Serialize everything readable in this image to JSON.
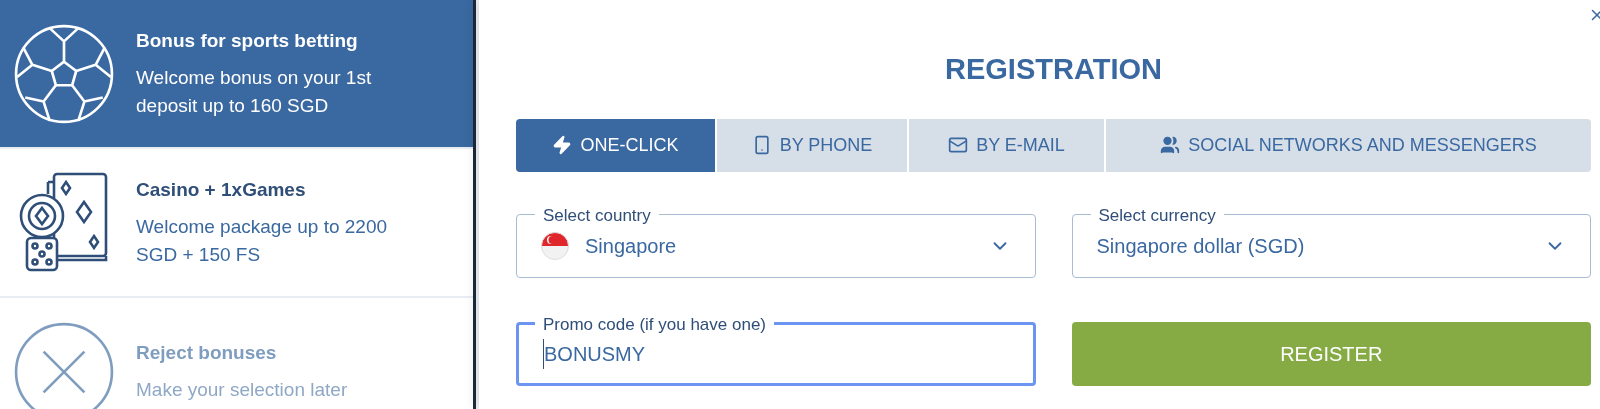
{
  "bonuses": [
    {
      "kind": "sports",
      "title": "Bonus for sports betting",
      "description": "Welcome bonus on your 1st deposit up to 160 SGD",
      "selected": true
    },
    {
      "kind": "casino",
      "title": "Casino + 1xGames",
      "description": "Welcome package up to 2200 SGD + 150 FS",
      "selected": false
    },
    {
      "kind": "reject",
      "title": "Reject bonuses",
      "description": "Make your selection later",
      "selected": false
    }
  ],
  "registration": {
    "title": "REGISTRATION",
    "tabs": [
      {
        "kind": "bolt",
        "label": "ONE-CLICK",
        "selected": true
      },
      {
        "kind": "phone",
        "label": "BY PHONE",
        "selected": false
      },
      {
        "kind": "mail",
        "label": "BY E-MAIL",
        "selected": false
      },
      {
        "kind": "people",
        "label": "SOCIAL NETWORKS AND MESSENGERS",
        "selected": false
      }
    ],
    "country": {
      "label": "Select country",
      "value": "Singapore"
    },
    "currency": {
      "label": "Select currency",
      "value": "Singapore dollar (SGD)"
    },
    "promo": {
      "label": "Promo code (if you have one)",
      "value": "BONUSMY",
      "focused": true
    },
    "register_button": "REGISTER"
  }
}
